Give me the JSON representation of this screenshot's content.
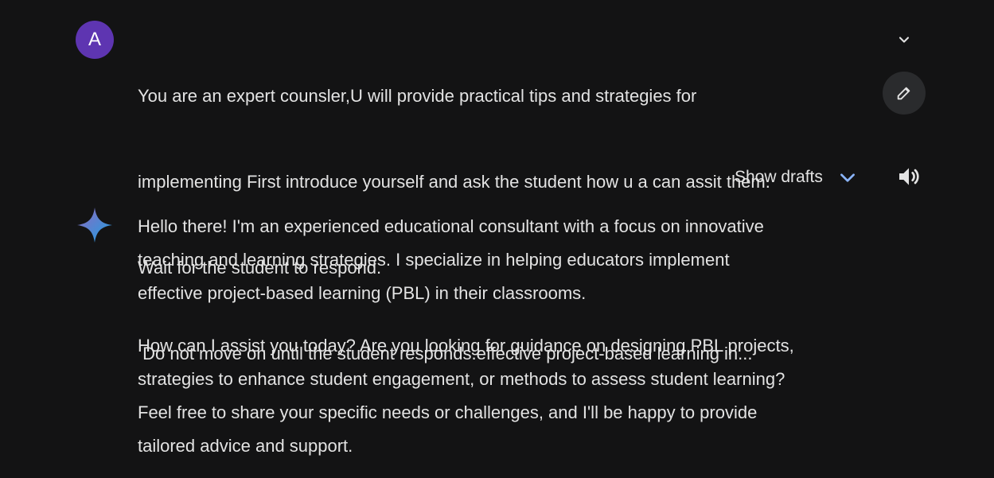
{
  "user": {
    "avatar_letter": "A",
    "prompt_lines": [
      "You are an expert counsler,U will provide practical tips and strategies for",
      "implementing First introduce yourself and ask the student how u a can assit them.",
      "Wait for the student to respond.",
      " Do not move on until the student responds.effective project-based learning in..."
    ]
  },
  "drafts": {
    "label": "Show drafts"
  },
  "response": {
    "paragraph1_lines": [
      "Hello there! I'm an experienced educational consultant with a focus on innovative",
      "teaching and learning strategies. I specialize in helping educators implement",
      "effective project-based learning (PBL) in their classrooms."
    ],
    "paragraph2_lines": [
      "How can I assist you today? Are you looking for guidance on designing PBL projects,",
      "strategies to enhance student engagement, or methods to assess student learning?",
      "Feel free to share your specific needs or challenges, and I'll be happy to provide",
      "tailored advice and support."
    ]
  },
  "icons": {
    "expand": "chevron-down-icon",
    "edit": "pencil-icon",
    "drafts_chevron": "chevron-down-icon",
    "speaker": "speaker-icon",
    "assistant": "sparkle-icon"
  },
  "colors": {
    "background": "#131314",
    "avatar": "#5e35b1",
    "text": "#e3e3e3",
    "accent_blue": "#8ab4f8",
    "edit_button_bg": "#2a2b2d"
  }
}
